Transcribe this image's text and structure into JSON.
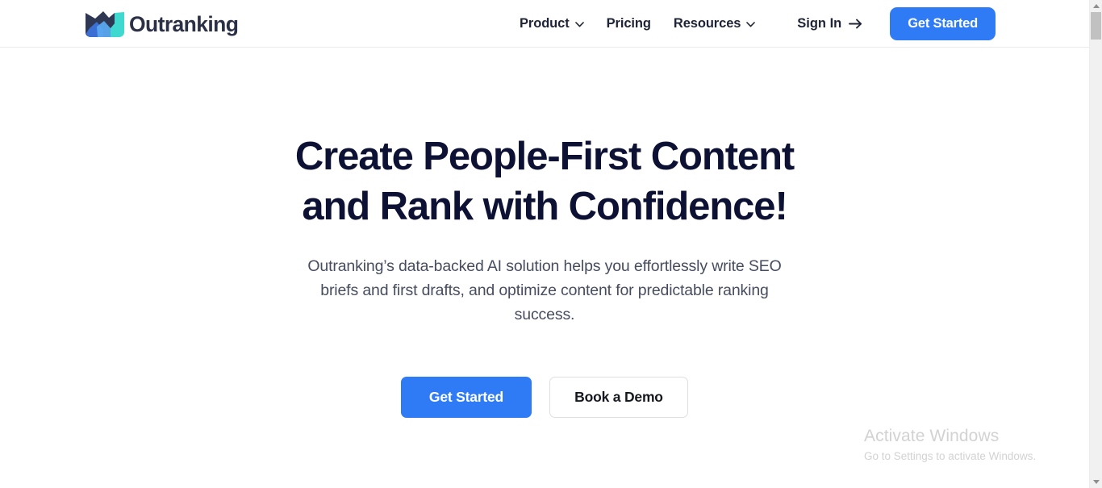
{
  "header": {
    "logo": {
      "name": "Outranking",
      "mark_icon": "mountain-chart-logo-icon",
      "colors": {
        "dark": "#2f3852",
        "blue": "#3b6fd4",
        "light_blue": "#4aa3e8",
        "teal": "#3fd9d0",
        "wordmark": "#2b3047"
      }
    },
    "nav": [
      {
        "label": "Product",
        "has_dropdown": true,
        "icon": "chevron-down-icon"
      },
      {
        "label": "Pricing",
        "has_dropdown": false,
        "icon": ""
      },
      {
        "label": "Resources",
        "has_dropdown": true,
        "icon": "chevron-down-icon"
      }
    ],
    "sign_in": {
      "label": "Sign In",
      "icon": "arrow-right-icon"
    },
    "cta": {
      "label": "Get Started",
      "color": "#2f7bf6"
    }
  },
  "hero": {
    "title_line_1": "Create People-First Content",
    "title_line_2": "and Rank with Confidence!",
    "title_color": "#0d1133",
    "subtitle": "Outranking’s data-backed AI solution helps you effortlessly write SEO briefs and first drafts, and optimize content for predictable ranking success.",
    "subtitle_color": "#474d5f",
    "buttons": {
      "primary": {
        "label": "Get Started",
        "color": "#2f7bf6"
      },
      "secondary": {
        "label": "Book a Demo",
        "border_color": "#dcdfe4"
      }
    }
  },
  "watermark": {
    "title": "Activate Windows",
    "subtitle": "Go to Settings to activate Windows.",
    "color": "#d2d2d2"
  },
  "scrollbar": {
    "up_icon": "scroll-up-arrow-icon",
    "down_icon": "scroll-down-arrow-icon",
    "thumb_color": "#c1c1c1",
    "track_color": "#f1f1f1"
  }
}
